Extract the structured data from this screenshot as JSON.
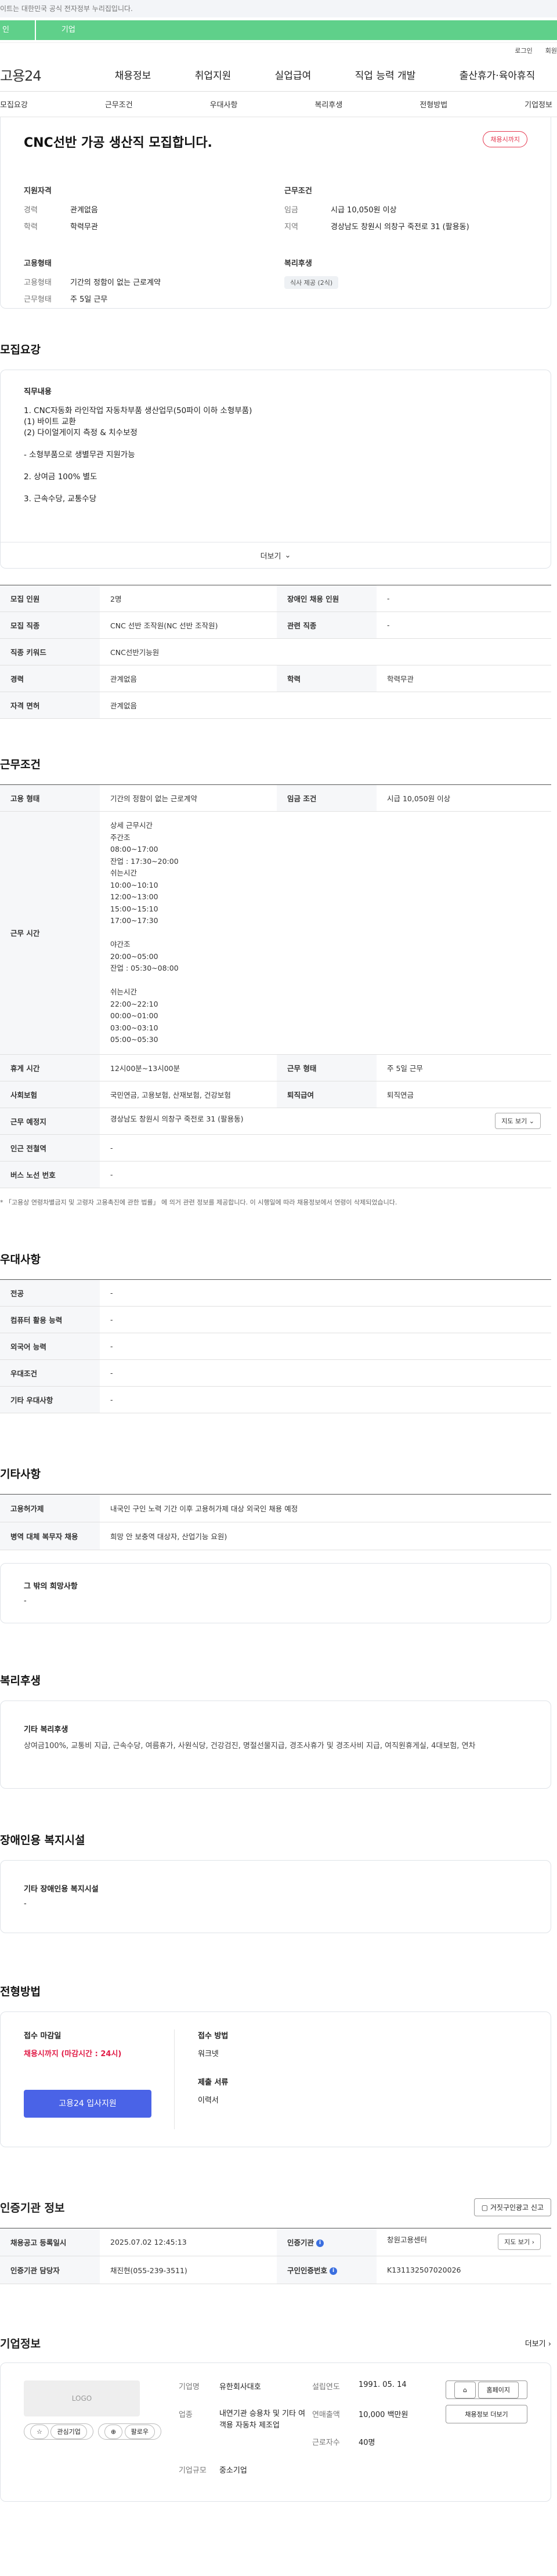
{
  "notice": "이트는 대한민국 공식 전자정부 누리집입니다.",
  "top_tabs": [
    "인",
    "기업"
  ],
  "util": [
    "로그인",
    "회원"
  ],
  "logo": "고용24",
  "gnb": [
    "채용정보",
    "취업지원",
    "실업급여",
    "직업 능력 개발",
    "출산휴가·육아휴직"
  ],
  "subnav": [
    "모집요강",
    "근무조건",
    "우대사항",
    "복리후생",
    "전형방법",
    "기업정보"
  ],
  "summary": {
    "title": "CNC선반 가공 생산직 모집합니다.",
    "status": "채용시까지",
    "qual": {
      "h": "지원자격",
      "rows": [
        [
          "경력",
          "관계없음"
        ],
        [
          "학력",
          "학력무관"
        ]
      ]
    },
    "cond": {
      "h": "근무조건",
      "rows": [
        [
          "임금",
          "시급 10,050원 이상"
        ],
        [
          "지역",
          "경상남도 창원시 의창구 죽전로 31 (팔용동)"
        ]
      ]
    },
    "emp": {
      "h": "고용형태",
      "rows": [
        [
          "고용형태",
          "기간의 정함이 없는 근로계약"
        ],
        [
          "근무형태",
          "주 5일 근무"
        ]
      ]
    },
    "welfare": {
      "h": "복리후생",
      "chip": "식사 제공 (2식)"
    }
  },
  "recruit": {
    "title": "모집요강",
    "body_label": "직무내용",
    "body": [
      "1. CNC자동화 라인작업 자동차부품 생산업무(50파이 이하 소형부품)",
      "(1) 바이트 교환",
      "(2) 다이얼게이지 측정 & 치수보정",
      "",
      "- 소형부품으로 생별무관 지원가능",
      "",
      "2. 상여금 100% 별도",
      "",
      "3. 근속수당, 교통수당"
    ],
    "more": "더보기",
    "table": [
      [
        "모집 인원",
        "2명",
        "장애인 채용 인원",
        "-"
      ],
      [
        "모집 직종",
        "CNC 선반 조작원(NC 선반 조작원)",
        "관련 직종",
        "-"
      ],
      [
        "직종 키워드",
        "CNC선반기능원"
      ],
      [
        "경력",
        "관계없음",
        "학력",
        "학력무관"
      ],
      [
        "자격 면허",
        "관계없음"
      ]
    ]
  },
  "cond": {
    "title": "근무조건",
    "r1": [
      "고용 형태",
      "기간의 정함이 없는 근로계약",
      "임금 조건",
      "시급 10,050원 이상"
    ],
    "time_label": "근무 시간",
    "time_lines": [
      "상세 근무시간",
      "주간조",
      "08:00~17:00",
      "잔업 : 17:30~20:00",
      "쉬는시간",
      "10:00~10:10",
      "12:00~13:00",
      "15:00~15:10",
      "17:00~17:30",
      "",
      "야간조",
      "20:00~05:00",
      "잔업 : 05:30~08:00",
      "",
      "쉬는시간",
      "22:00~22:10",
      "00:00~01:00",
      "03:00~03:10",
      "05:00~05:30"
    ],
    "r3": [
      "휴게 시간",
      "12시00분~13시00분",
      "근무 형태",
      "주 5일 근무"
    ],
    "r4": [
      "사회보험",
      "국민연금, 고용보험, 산재보험, 건강보험",
      "퇴직급여",
      "퇴직연금"
    ],
    "r5": [
      "근무 예정지",
      "경상남도 창원시 의창구 죽전로 31 (팔용동)"
    ],
    "map_btn": "지도 보기",
    "r6": [
      "인근 전철역",
      "-"
    ],
    "r7": [
      "버스 노선 번호",
      "-"
    ],
    "footnote": "* 「고용상 연령차별금지 및 고령자 고용촉진에 관한 법률」 에 의거 관련 정보를 제공합니다. 이 시행일에 따라 채용정보에서 연령이 삭제되었습니다."
  },
  "pref": {
    "title": "우대사항",
    "rows": [
      [
        "전공",
        "-"
      ],
      [
        "컴퓨터 활용 능력",
        "-"
      ],
      [
        "외국어 능력",
        "-"
      ],
      [
        "우대조건",
        "-"
      ],
      [
        "기타 우대사항",
        "-"
      ]
    ]
  },
  "etc": {
    "title": "기타사항",
    "rows": [
      [
        "고용허가제",
        "내국인 구인 노력 기간 이후 고용허가제 대상 외국인 채용 예정"
      ],
      [
        "병역 대체 복무자 채용",
        "희망 안 보충역 대상자, 산업기능 요원)"
      ]
    ],
    "other_h": "그 밖의 희망사항",
    "other_v": "-"
  },
  "welfare": {
    "title": "복리후생",
    "h": "기타 복리후생",
    "v": "상여금100%, 교통비 지급, 근속수당, 여름휴가, 사원식당, 건강검진, 명절선물지급, 경조사휴가 및 경조사비 지급, 여직원휴게실, 4대보험, 연차"
  },
  "disab": {
    "title": "장애인용 복지시설",
    "h": "기타 장애인용 복지시설",
    "v": "-"
  },
  "apply": {
    "title": "전형방법",
    "deadline_h": "접수 마감일",
    "deadline_v": "채용시까지 (마감시간 : 24시)",
    "button": "고용24 입사지원",
    "method_h": "접수 방법",
    "method_v": "워크넷",
    "docs_h": "제출 서류",
    "docs_v": "이력서"
  },
  "agency": {
    "title": "인증기관 정보",
    "btn": "거짓구인광고 신고",
    "r1": [
      "채용공고 등록일시",
      "2025.07.02 12:45:13",
      "인증기관",
      "창원고용센터"
    ],
    "map_btn": "지도 보기",
    "r2": [
      "인증기관 담당자",
      "채진현(055-239-3511)",
      "구인인증번호",
      "K131132507020026"
    ]
  },
  "company": {
    "title": "기업정보",
    "more": "더보기",
    "logo": "LOGO",
    "fav": "관심기업",
    "follow": "팔로우",
    "rows": [
      [
        "기업명",
        "유한회사대호",
        "설립연도",
        "1991. 05. 14"
      ],
      [
        "업종",
        "내연기관 승용차 및 기타 여객용 자동차 제조업",
        "연매출액",
        "10,000 백만원"
      ],
      [
        "",
        "",
        "근로자수",
        "40명"
      ],
      [
        "기업규모",
        "중소기업",
        "",
        ""
      ]
    ],
    "btn1": "홈페이지",
    "btn2": "채용정보 더보기"
  }
}
